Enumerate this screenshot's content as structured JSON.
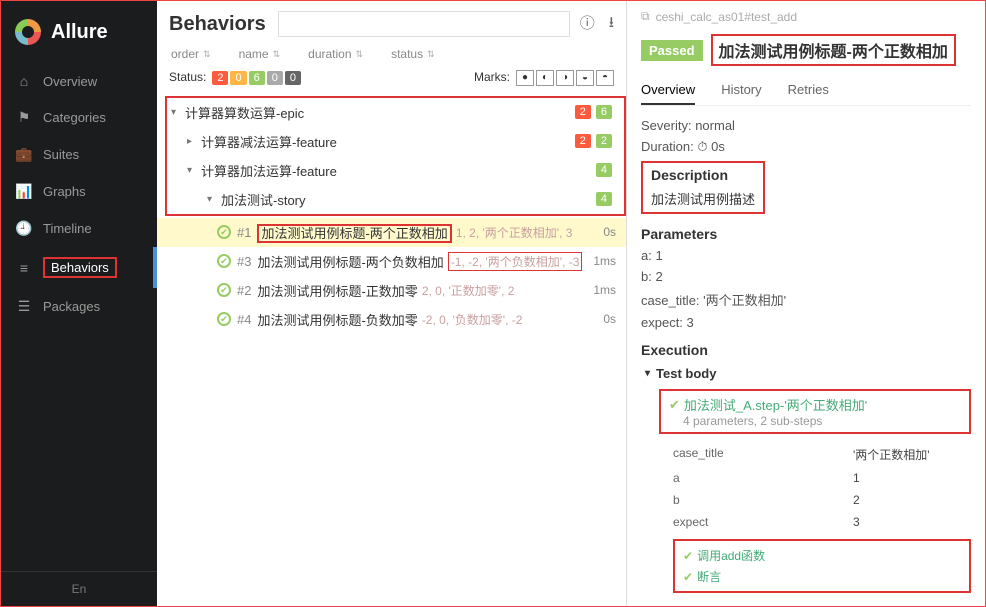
{
  "brand": "Allure",
  "nav": [
    {
      "icon": "⌂",
      "label": "Overview"
    },
    {
      "icon": "⚑",
      "label": "Categories"
    },
    {
      "icon": "💼",
      "label": "Suites"
    },
    {
      "icon": "📊",
      "label": "Graphs"
    },
    {
      "icon": "🕘",
      "label": "Timeline"
    },
    {
      "icon": "≡",
      "label": "Behaviors",
      "active": true
    },
    {
      "icon": "☰",
      "label": "Packages"
    }
  ],
  "lang": "En",
  "mid": {
    "title": "Behaviors",
    "sort_cols": [
      "order",
      "name",
      "duration",
      "status"
    ],
    "status_label": "Status:",
    "status_counts": [
      "2",
      "0",
      "6",
      "0",
      "0"
    ],
    "marks_label": "Marks:",
    "mark_icons": [
      "●",
      "◐",
      "◑",
      "◒",
      "◓"
    ]
  },
  "tree": {
    "epic": {
      "label": "计算器算数运算-epic",
      "badges": [
        "2",
        "6"
      ]
    },
    "feat1": {
      "label": "计算器减法运算-feature",
      "badges": [
        "2",
        "2"
      ]
    },
    "feat2": {
      "label": "计算器加法运算-feature",
      "badges": [
        "4"
      ]
    },
    "story": {
      "label": "加法测试-story",
      "badges": [
        "4"
      ]
    },
    "cases": [
      {
        "num": "#1",
        "title": "加法测试用例标题-两个正数相加",
        "params": "1, 2, '两个正数相加', 3",
        "dur": "0s",
        "selected": true,
        "title_boxed": true
      },
      {
        "num": "#3",
        "title": "加法测试用例标题-两个负数相加",
        "params": "-1, -2, '两个负数相加', -3",
        "dur": "1ms",
        "params_boxed": true
      },
      {
        "num": "#2",
        "title": "加法测试用例标题-正数加零",
        "params": "2, 0, '正数加零', 2",
        "dur": "1ms"
      },
      {
        "num": "#4",
        "title": "加法测试用例标题-负数加零",
        "params": "-2, 0, '负数加零', -2",
        "dur": "0s"
      }
    ]
  },
  "detail": {
    "breadcrumb": "ceshi_calc_as01#test_add",
    "status": "Passed",
    "title": "加法测试用例标题-两个正数相加",
    "tabs": [
      "Overview",
      "History",
      "Retries"
    ],
    "severity_label": "Severity:",
    "severity": "normal",
    "duration_label": "Duration:",
    "duration": "⏱ 0s",
    "desc_heading": "Description",
    "description": "加法测试用例描述",
    "params_heading": "Parameters",
    "params": [
      {
        "k": "a:",
        "v": "1"
      },
      {
        "k": "b:",
        "v": "2"
      },
      {
        "k": "case_title:",
        "v": "'两个正数相加'"
      },
      {
        "k": "expect:",
        "v": "3"
      }
    ],
    "exec_heading": "Execution",
    "body_label": "Test body",
    "step_name": "加法测试_A.step-'两个正数相加'",
    "step_sub": "4 parameters, 2 sub-steps",
    "step_table": [
      {
        "k": "case_title",
        "v": "'两个正数相加'"
      },
      {
        "k": "a",
        "v": "1"
      },
      {
        "k": "b",
        "v": "2"
      },
      {
        "k": "expect",
        "v": "3"
      }
    ],
    "substeps": [
      "调用add函数",
      "断言"
    ]
  }
}
